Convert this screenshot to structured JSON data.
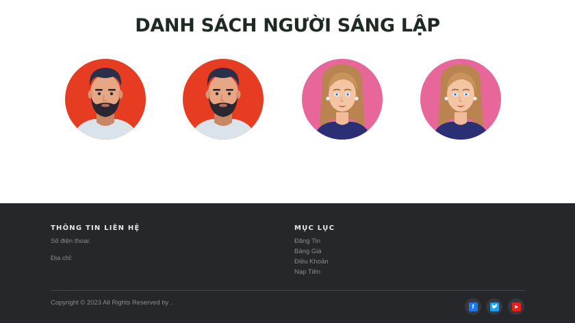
{
  "header": {
    "title": "DANH SÁCH NGƯỜI SÁNG LẬP"
  },
  "founders": [
    {
      "avatar": "male-bearded-avatar",
      "bg_color": "#e63c22"
    },
    {
      "avatar": "male-bearded-avatar",
      "bg_color": "#e63c22"
    },
    {
      "avatar": "female-blonde-avatar",
      "bg_color": "#e8679a"
    },
    {
      "avatar": "female-blonde-avatar",
      "bg_color": "#e8679a"
    }
  ],
  "footer": {
    "contact": {
      "title": "THÔNG TIN LIÊN HỆ",
      "phone_label": "Số điện thoại:",
      "address_label": "Địa chỉ:"
    },
    "menu": {
      "title": "MỤC LỤC",
      "items": [
        "Đăng Tin",
        "Bảng Giá",
        "Điều Khoản",
        "Nạp Tiền"
      ]
    },
    "copyright": "Copyright © 2023 All Rights Reserved by .",
    "social": [
      {
        "icon": "facebook-icon",
        "color": "#1877f2"
      },
      {
        "icon": "twitter-icon",
        "color": "#1da1f2"
      },
      {
        "icon": "youtube-icon",
        "color": "#e62117"
      }
    ],
    "bg_color": "#25272b"
  }
}
